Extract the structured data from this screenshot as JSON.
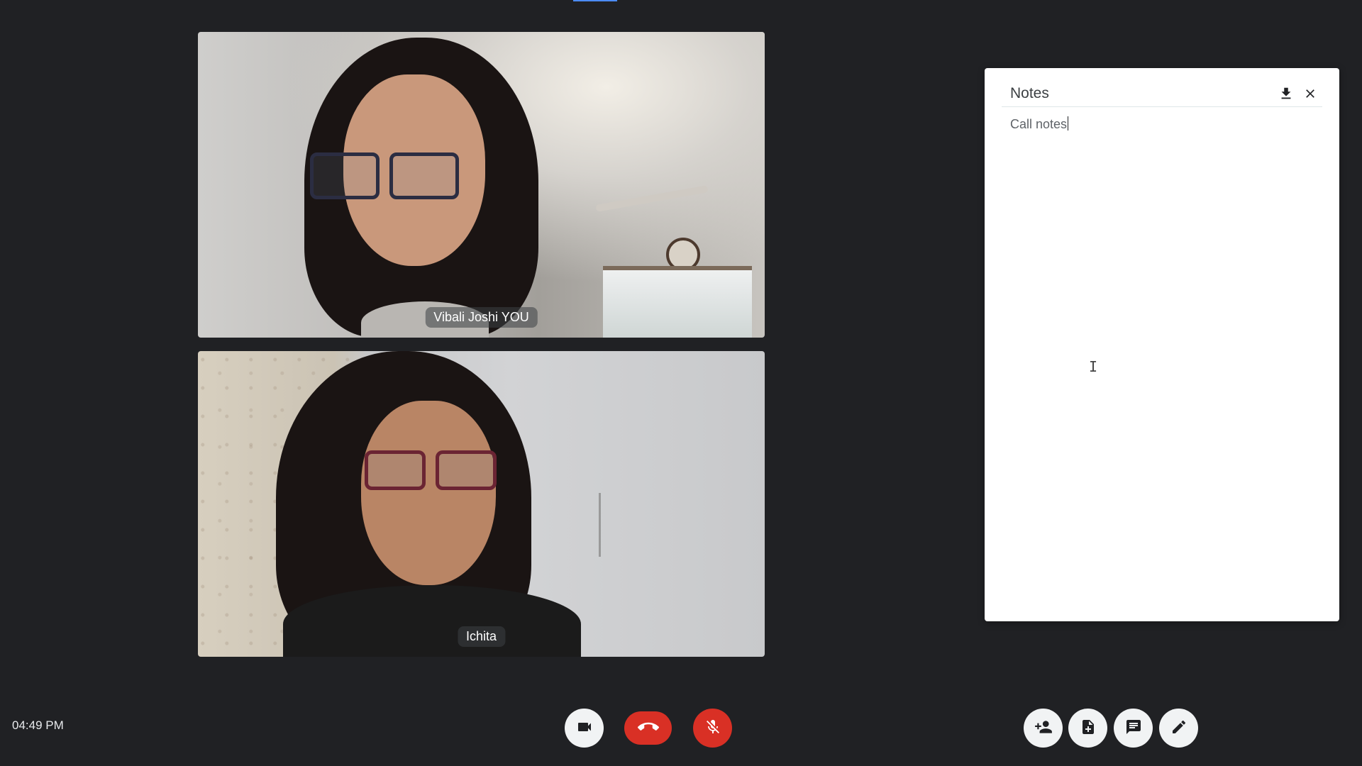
{
  "participants": [
    {
      "name": "Vibali Joshi YOU"
    },
    {
      "name": "Ichita"
    }
  ],
  "notes": {
    "title": "Notes",
    "content": "Call notes",
    "download_icon": "download-icon",
    "close_icon": "close-icon"
  },
  "status": {
    "time": "04:49 PM"
  },
  "controls": {
    "camera_icon": "video-camera-icon",
    "end_call_icon": "end-call-icon",
    "mic_icon": "mic-off-icon",
    "add_people_icon": "add-person-icon",
    "add_file_icon": "add-file-icon",
    "chat_icon": "chat-icon",
    "notes_icon": "pencil-icon"
  },
  "colors": {
    "background": "#202124",
    "danger": "#d93025",
    "button_light": "#f1f3f4",
    "panel": "#ffffff"
  }
}
